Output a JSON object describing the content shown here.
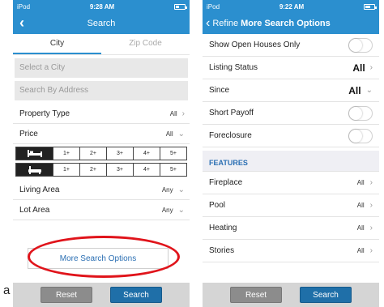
{
  "left": {
    "status": {
      "carrier": "iPod",
      "time": "9:28 AM"
    },
    "nav": {
      "title": "Search"
    },
    "tabs": [
      {
        "label": "City"
      },
      {
        "label": "Zip Code"
      }
    ],
    "fields": {
      "city_placeholder": "Select a City",
      "address_placeholder": "Search By Address"
    },
    "rows": {
      "property_type": {
        "label": "Property Type",
        "value": "All"
      },
      "price": {
        "label": "Price",
        "value": "All"
      },
      "living_area": {
        "label": "Living Area",
        "value": "Any"
      },
      "lot_area": {
        "label": "Lot Area",
        "value": "Any"
      }
    },
    "bed_options": [
      "1+",
      "2+",
      "3+",
      "4+",
      "5+"
    ],
    "bath_options": [
      "1+",
      "2+",
      "3+",
      "4+",
      "5+"
    ],
    "more_label": "More Search Options",
    "reset_label": "Reset",
    "search_label": "Search",
    "stray_char": "a"
  },
  "right": {
    "status": {
      "carrier": "iPod",
      "time": "9:22 AM"
    },
    "nav": {
      "back_label": "Refine",
      "title": "More Search Options"
    },
    "rows": {
      "open_houses": {
        "label": "Show Open Houses Only"
      },
      "listing_status": {
        "label": "Listing Status",
        "value": "All"
      },
      "since": {
        "label": "Since",
        "value": "All"
      },
      "short_payoff": {
        "label": "Short Payoff"
      },
      "foreclosure": {
        "label": "Foreclosure"
      }
    },
    "section_title": "FEATURES",
    "features": [
      {
        "label": "Fireplace",
        "value": "All"
      },
      {
        "label": "Pool",
        "value": "All"
      },
      {
        "label": "Heating",
        "value": "All"
      },
      {
        "label": "Stories",
        "value": "All"
      }
    ],
    "reset_label": "Reset",
    "search_label": "Search"
  },
  "colors": {
    "accent": "#2b8fcf",
    "highlight": "#e0141b",
    "button": "#1f6fa8"
  }
}
